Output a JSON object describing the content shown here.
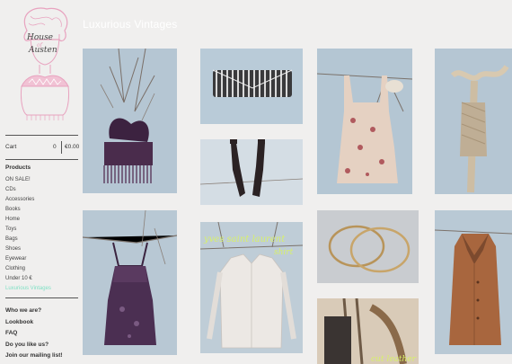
{
  "brand": {
    "line1": "House",
    "line2": "Austen"
  },
  "page_title": "Luxurious Vintages",
  "cart": {
    "label": "Cart",
    "count": "0",
    "total": "€0.00"
  },
  "products_heading": "Products",
  "categories": [
    {
      "label": "ON SALE!"
    },
    {
      "label": "CDs"
    },
    {
      "label": "Accessories"
    },
    {
      "label": "Books"
    },
    {
      "label": "Home"
    },
    {
      "label": "Toys"
    },
    {
      "label": "Bags"
    },
    {
      "label": "Shoes"
    },
    {
      "label": "Eyewear"
    },
    {
      "label": "Clothing"
    },
    {
      "label": "Under 10 €"
    },
    {
      "label": "Luxurious Vintages"
    }
  ],
  "bottom_links": [
    {
      "label": "Who we are?"
    },
    {
      "label": "Lookbook"
    },
    {
      "label": "FAQ"
    },
    {
      "label": "Do you like us?"
    },
    {
      "label": "Join our mailing list!"
    }
  ],
  "products": [
    {
      "name": "fringed-velvet-bag"
    },
    {
      "name": "sequin-clutch"
    },
    {
      "name": "long-leather-gloves"
    },
    {
      "name": "floral-slip-dress"
    },
    {
      "name": "branch-with-lace-top"
    },
    {
      "name": "purple-velvet-dress"
    },
    {
      "name": "white-ysl-shirt"
    },
    {
      "name": "gold-bangles"
    },
    {
      "name": "leather-accessory"
    },
    {
      "name": "brown-fur-collar-coat"
    }
  ],
  "tile_captions": {
    "ysl_line1": "yves saint laurent",
    "ysl_line2": "shirt",
    "leather": "cut leather"
  },
  "colors": {
    "accent": "#7fe0c4",
    "sky": "#b9c8d3",
    "sidebar_text": "#333333",
    "logo_pink": "#e8a3bf"
  }
}
